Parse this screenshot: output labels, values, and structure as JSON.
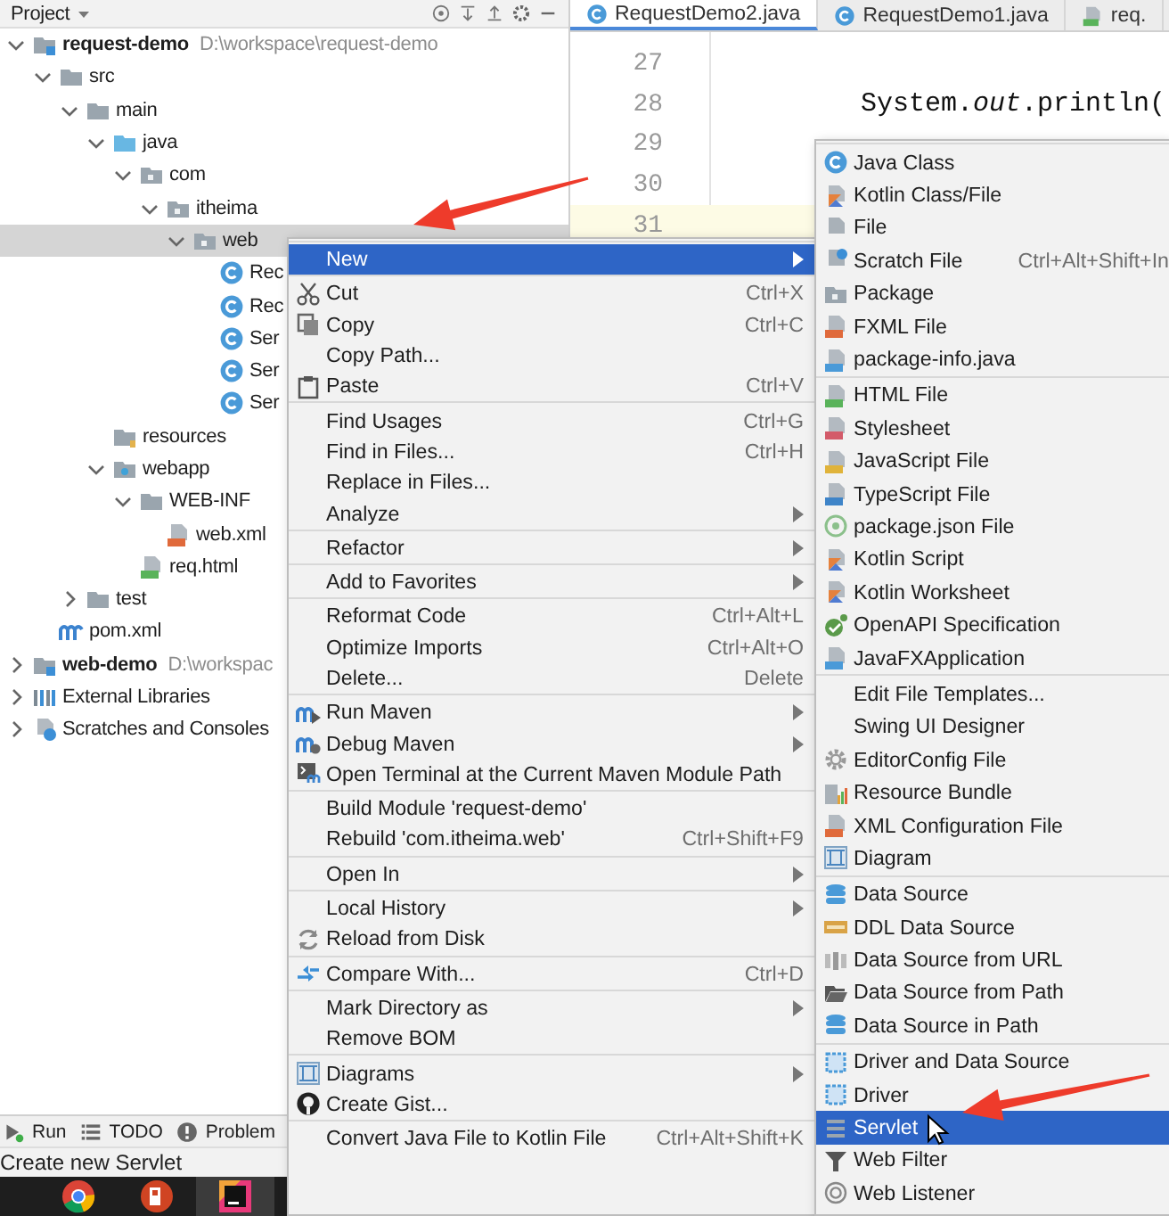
{
  "project": {
    "title": "Project",
    "tree": [
      {
        "label": "request-demo",
        "path": "D:\\workspace\\request-demo",
        "kind": "module",
        "expanded": true,
        "selected": false,
        "children": [
          {
            "label": "src",
            "kind": "folder",
            "expanded": true,
            "selected": false,
            "children": [
              {
                "label": "main",
                "kind": "folder",
                "expanded": true,
                "selected": false,
                "children": [
                  {
                    "label": "java",
                    "kind": "source",
                    "expanded": true,
                    "selected": false,
                    "children": [
                      {
                        "label": "com",
                        "kind": "package",
                        "expanded": true,
                        "selected": false,
                        "children": [
                          {
                            "label": "itheima",
                            "kind": "package",
                            "expanded": true,
                            "selected": false,
                            "children": [
                              {
                                "label": "web",
                                "kind": "package",
                                "expanded": true,
                                "selected": true,
                                "children": [
                                  {
                                    "label": "Rec",
                                    "kind": "class",
                                    "selected": false
                                  },
                                  {
                                    "label": "Rec",
                                    "kind": "class",
                                    "selected": false
                                  },
                                  {
                                    "label": "Ser",
                                    "kind": "class",
                                    "selected": false
                                  },
                                  {
                                    "label": "Ser",
                                    "kind": "class",
                                    "selected": false
                                  },
                                  {
                                    "label": "Ser",
                                    "kind": "class",
                                    "selected": false
                                  }
                                ]
                              }
                            ]
                          }
                        ]
                      }
                    ]
                  },
                  {
                    "label": "resources",
                    "kind": "resources",
                    "selected": false
                  },
                  {
                    "label": "webapp",
                    "kind": "webapp",
                    "expanded": true,
                    "selected": false,
                    "children": [
                      {
                        "label": "WEB-INF",
                        "kind": "folder",
                        "expanded": true,
                        "selected": false,
                        "children": [
                          {
                            "label": "web.xml",
                            "kind": "xml",
                            "selected": false
                          }
                        ]
                      },
                      {
                        "label": "req.html",
                        "kind": "html",
                        "selected": false
                      }
                    ]
                  }
                ]
              },
              {
                "label": "test",
                "kind": "folder",
                "expanded": false,
                "selected": false
              }
            ]
          },
          {
            "label": "pom.xml",
            "kind": "maven",
            "selected": false
          }
        ]
      },
      {
        "label": "web-demo",
        "path": "D:\\workspac",
        "kind": "module",
        "expanded": false,
        "selected": false
      },
      {
        "label": "External Libraries",
        "kind": "libraries",
        "expanded": false,
        "selected": false
      },
      {
        "label": "Scratches and Consoles",
        "kind": "scratches",
        "expanded": false,
        "selected": false
      }
    ]
  },
  "editor": {
    "tabs": [
      {
        "label": "RequestDemo2.java",
        "kind": "class",
        "selected": true
      },
      {
        "label": "RequestDemo1.java",
        "kind": "class",
        "selected": false
      },
      {
        "label": "req.",
        "kind": "html",
        "selected": false
      }
    ],
    "lines": [
      {
        "number": "27",
        "current": false
      },
      {
        "number": "28",
        "code": "System.*out*.println(",
        "current": false
      },
      {
        "number": "29",
        "current": false
      },
      {
        "number": "30",
        "current": false
      },
      {
        "number": "31",
        "current": true
      }
    ]
  },
  "context_menu": {
    "groups": [
      {
        "items": [
          {
            "label": "New",
            "kind": "plain",
            "submenu": true,
            "selected": true
          }
        ]
      },
      {
        "items": [
          {
            "label": "Cut",
            "kind": "cut",
            "shortcut": "Ctrl+X",
            "submenu": false,
            "selected": false
          },
          {
            "label": "Copy",
            "kind": "copy",
            "shortcut": "Ctrl+C",
            "submenu": false,
            "selected": false
          },
          {
            "label": "Copy Path...",
            "kind": "plain",
            "submenu": false,
            "selected": false
          },
          {
            "label": "Paste",
            "kind": "paste",
            "shortcut": "Ctrl+V",
            "submenu": false,
            "selected": false
          }
        ]
      },
      {
        "items": [
          {
            "label": "Find Usages",
            "kind": "plain",
            "shortcut": "Ctrl+G",
            "submenu": false,
            "selected": false
          },
          {
            "label": "Find in Files...",
            "kind": "plain",
            "shortcut": "Ctrl+H",
            "submenu": false,
            "selected": false
          },
          {
            "label": "Replace in Files...",
            "kind": "plain",
            "submenu": false,
            "selected": false
          },
          {
            "label": "Analyze",
            "kind": "plain",
            "submenu": true,
            "selected": false
          }
        ]
      },
      {
        "items": [
          {
            "label": "Refactor",
            "kind": "plain",
            "submenu": true,
            "selected": false
          }
        ]
      },
      {
        "items": [
          {
            "label": "Add to Favorites",
            "kind": "plain",
            "submenu": true,
            "selected": false
          }
        ]
      },
      {
        "items": [
          {
            "label": "Reformat Code",
            "kind": "plain",
            "shortcut": "Ctrl+Alt+L",
            "submenu": false,
            "selected": false
          },
          {
            "label": "Optimize Imports",
            "kind": "plain",
            "shortcut": "Ctrl+Alt+O",
            "submenu": false,
            "selected": false
          },
          {
            "label": "Delete...",
            "kind": "plain",
            "shortcut": "Delete",
            "submenu": false,
            "selected": false
          }
        ]
      },
      {
        "items": [
          {
            "label": "Run Maven",
            "kind": "maven-run",
            "submenu": true,
            "selected": false
          },
          {
            "label": "Debug Maven",
            "kind": "maven-debug",
            "submenu": true,
            "selected": false
          },
          {
            "label": "Open Terminal at the Current Maven Module Path",
            "kind": "terminal",
            "submenu": false,
            "selected": false
          }
        ]
      },
      {
        "items": [
          {
            "label": "Build Module 'request-demo'",
            "kind": "plain",
            "submenu": false,
            "selected": false
          },
          {
            "label": "Rebuild 'com.itheima.web'",
            "kind": "plain",
            "shortcut": "Ctrl+Shift+F9",
            "submenu": false,
            "selected": false
          }
        ]
      },
      {
        "items": [
          {
            "label": "Open In",
            "kind": "plain",
            "submenu": true,
            "selected": false
          }
        ]
      },
      {
        "items": [
          {
            "label": "Local History",
            "kind": "plain",
            "submenu": true,
            "selected": false
          },
          {
            "label": "Reload from Disk",
            "kind": "reload",
            "submenu": false,
            "selected": false
          }
        ]
      },
      {
        "items": [
          {
            "label": "Compare With...",
            "kind": "compare",
            "shortcut": "Ctrl+D",
            "submenu": false,
            "selected": false
          }
        ]
      },
      {
        "items": [
          {
            "label": "Mark Directory as",
            "kind": "plain",
            "submenu": true,
            "selected": false
          },
          {
            "label": "Remove BOM",
            "kind": "plain",
            "submenu": false,
            "selected": false
          }
        ]
      },
      {
        "items": [
          {
            "label": "Diagrams",
            "kind": "diagram",
            "submenu": true,
            "selected": false
          },
          {
            "label": "Create Gist...",
            "kind": "github",
            "submenu": false,
            "selected": false
          }
        ]
      },
      {
        "items": [
          {
            "label": "Convert Java File to Kotlin File",
            "kind": "plain",
            "shortcut": "Ctrl+Alt+Shift+K",
            "submenu": false,
            "selected": false
          }
        ]
      }
    ]
  },
  "new_submenu": {
    "groups": [
      {
        "items": [
          {
            "label": "Java Class",
            "kind": "class",
            "selected": false
          },
          {
            "label": "Kotlin Class/File",
            "kind": "kotlin",
            "selected": false
          },
          {
            "label": "File",
            "kind": "file",
            "selected": false
          },
          {
            "label": "Scratch File",
            "kind": "scratch",
            "shortcut": "Ctrl+Alt+Shift+In",
            "selected": false
          },
          {
            "label": "Package",
            "kind": "package",
            "selected": false
          },
          {
            "label": "FXML File",
            "kind": "fxml",
            "selected": false
          },
          {
            "label": "package-info.java",
            "kind": "java-file",
            "selected": false
          }
        ]
      },
      {
        "items": [
          {
            "label": "HTML File",
            "kind": "html",
            "selected": false
          },
          {
            "label": "Stylesheet",
            "kind": "css",
            "selected": false
          },
          {
            "label": "JavaScript File",
            "kind": "js",
            "selected": false
          },
          {
            "label": "TypeScript File",
            "kind": "ts",
            "selected": false
          },
          {
            "label": "package.json File",
            "kind": "npm",
            "selected": false
          },
          {
            "label": "Kotlin Script",
            "kind": "kotlin",
            "selected": false
          },
          {
            "label": "Kotlin Worksheet",
            "kind": "kotlin",
            "selected": false
          },
          {
            "label": "OpenAPI Specification",
            "kind": "openapi",
            "selected": false
          },
          {
            "label": "JavaFXApplication",
            "kind": "java-file",
            "selected": false
          }
        ]
      },
      {
        "items": [
          {
            "label": "Edit File Templates...",
            "kind": "plain",
            "selected": false
          },
          {
            "label": "Swing UI Designer",
            "kind": "plain",
            "selected": false
          },
          {
            "label": "EditorConfig File",
            "kind": "gear",
            "selected": false
          },
          {
            "label": "Resource Bundle",
            "kind": "bundle",
            "selected": false
          },
          {
            "label": "XML Configuration File",
            "kind": "fxml",
            "selected": false
          },
          {
            "label": "Diagram",
            "kind": "diagram",
            "selected": false
          }
        ]
      },
      {
        "items": [
          {
            "label": "Data Source",
            "kind": "database",
            "selected": false
          },
          {
            "label": "DDL Data Source",
            "kind": "ddl",
            "selected": false
          },
          {
            "label": "Data Source from URL",
            "kind": "db-url",
            "selected": false
          },
          {
            "label": "Data Source from Path",
            "kind": "folder-open",
            "selected": false
          },
          {
            "label": "Data Source in Path",
            "kind": "database",
            "selected": false
          }
        ]
      },
      {
        "items": [
          {
            "label": "Driver and Data Source",
            "kind": "driver",
            "selected": false
          },
          {
            "label": "Driver",
            "kind": "driver",
            "selected": false
          },
          {
            "label": "Servlet",
            "kind": "servlet",
            "selected": true
          },
          {
            "label": "Web Filter",
            "kind": "filter",
            "selected": false
          },
          {
            "label": "Web Listener",
            "kind": "listener",
            "selected": false
          }
        ]
      }
    ]
  },
  "tool_windows": [
    {
      "label": "Run",
      "kind": "run"
    },
    {
      "label": "TODO",
      "kind": "todo"
    },
    {
      "label": "Problem",
      "kind": "problems"
    }
  ],
  "status_bar": {
    "message": "Create new Servlet"
  },
  "taskbar": [
    {
      "kind": "browser",
      "selected": false
    },
    {
      "kind": "slides",
      "selected": false
    },
    {
      "kind": "ide",
      "selected": true
    }
  ]
}
